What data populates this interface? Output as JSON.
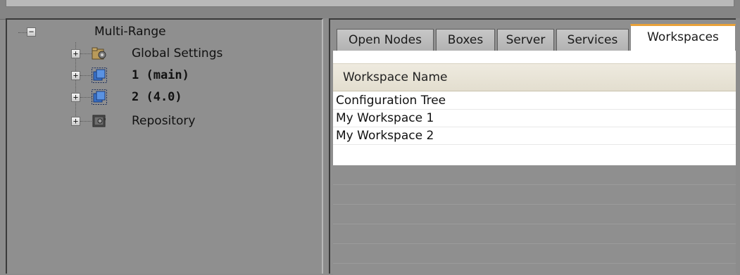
{
  "tree": {
    "root": {
      "label": "Multi-Range",
      "expander": "−"
    },
    "items": [
      {
        "label": "Global Settings",
        "icon": "gear-folder-icon",
        "expander": "+"
      },
      {
        "label": "1 (main)",
        "icon": "window-stack-icon",
        "expander": "+"
      },
      {
        "label": "2 (4.0)",
        "icon": "window-stack-icon",
        "expander": "+"
      },
      {
        "label": "Repository",
        "icon": "safe-icon",
        "expander": "+"
      }
    ]
  },
  "tabs": [
    {
      "label": "Open Nodes"
    },
    {
      "label": "Boxes"
    },
    {
      "label": "Server"
    },
    {
      "label": "Services"
    },
    {
      "label": "Workspaces",
      "active": true
    }
  ],
  "table": {
    "header": "Workspace Name",
    "rows": [
      "Configuration Tree",
      "My Workspace 1",
      "My Workspace 2"
    ]
  },
  "colors": {
    "active_tab_accent": "#e8a13a",
    "pane_background": "#8f8f8f",
    "header_background": "#e9e5d8"
  }
}
